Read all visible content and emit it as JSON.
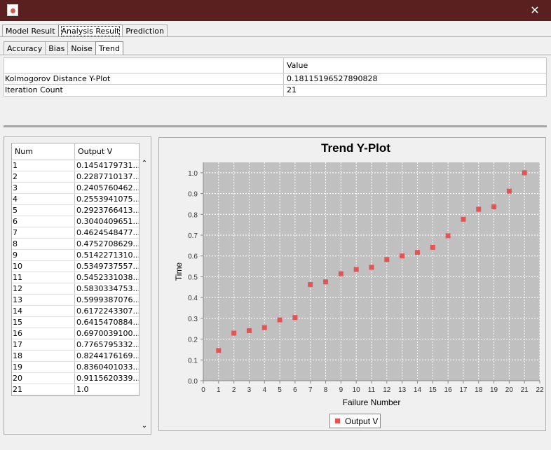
{
  "window": {
    "close_glyph": "✕"
  },
  "tabs_main": [
    "Model Result",
    "Analysis Result",
    "Prediction"
  ],
  "tabs_main_active": 1,
  "tabs_sub": [
    "Accuracy",
    "Bias",
    "Noise",
    "Trend"
  ],
  "tabs_sub_active": 3,
  "summary_table": {
    "header": [
      "",
      "Value"
    ],
    "rows": [
      [
        "Kolmogorov Distance Y-Plot",
        "0.18115196527890828"
      ],
      [
        "Iteration Count",
        "21"
      ]
    ]
  },
  "data_table": {
    "header": [
      "Num",
      "Output V"
    ],
    "rows": [
      [
        "1",
        "0.1454179731..."
      ],
      [
        "2",
        "0.2287710137..."
      ],
      [
        "3",
        "0.2405760462..."
      ],
      [
        "4",
        "0.2553941075..."
      ],
      [
        "5",
        "0.2923766413..."
      ],
      [
        "6",
        "0.3040409651..."
      ],
      [
        "7",
        "0.4624548477..."
      ],
      [
        "8",
        "0.4752708629..."
      ],
      [
        "9",
        "0.5142271310..."
      ],
      [
        "10",
        "0.5349737557..."
      ],
      [
        "11",
        "0.5452331038..."
      ],
      [
        "12",
        "0.5830334753..."
      ],
      [
        "13",
        "0.5999387076..."
      ],
      [
        "14",
        "0.6172243307..."
      ],
      [
        "15",
        "0.6415470884..."
      ],
      [
        "16",
        "0.6970039100..."
      ],
      [
        "17",
        "0.7765795332..."
      ],
      [
        "18",
        "0.8244176169..."
      ],
      [
        "19",
        "0.8360401033..."
      ],
      [
        "20",
        "0.9115620339..."
      ],
      [
        "21",
        "1.0"
      ]
    ]
  },
  "scroll": {
    "up_glyph": "⌃",
    "down_glyph": "⌄"
  },
  "colors": {
    "series": "#e15555",
    "plot_bg": "#c0c0c0",
    "titlebar": "#5a1f1f"
  },
  "chart_data": {
    "type": "scatter",
    "title": "Trend Y-Plot",
    "xlabel": "Failure Number",
    "ylabel": "Time",
    "xlim": [
      0,
      22
    ],
    "ylim": [
      0.0,
      1.05
    ],
    "xticks": [
      0,
      1,
      2,
      3,
      4,
      5,
      6,
      7,
      8,
      9,
      10,
      11,
      12,
      13,
      14,
      15,
      16,
      17,
      18,
      19,
      20,
      21,
      22
    ],
    "yticks": [
      "0.0",
      "0.1",
      "0.2",
      "0.3",
      "0.4",
      "0.5",
      "0.6",
      "0.7",
      "0.8",
      "0.9",
      "1.0"
    ],
    "grid": true,
    "legend": "bottom-center",
    "series": [
      {
        "name": "Output V",
        "x": [
          1,
          2,
          3,
          4,
          5,
          6,
          7,
          8,
          9,
          10,
          11,
          12,
          13,
          14,
          15,
          16,
          17,
          18,
          19,
          20,
          21
        ],
        "y": [
          0.1454,
          0.2288,
          0.2406,
          0.2554,
          0.2924,
          0.304,
          0.4625,
          0.4753,
          0.5142,
          0.535,
          0.5452,
          0.583,
          0.5999,
          0.6172,
          0.6415,
          0.697,
          0.7766,
          0.8244,
          0.836,
          0.9116,
          1.0
        ]
      }
    ]
  }
}
